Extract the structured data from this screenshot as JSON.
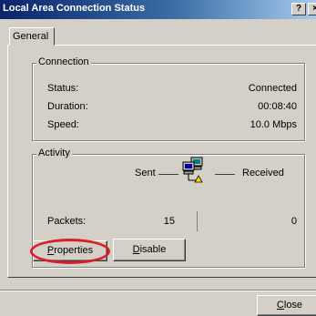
{
  "window": {
    "title": "Local Area Connection Status",
    "help_button": "?",
    "close_button": "×"
  },
  "tabs": [
    "General"
  ],
  "connection": {
    "group_label": "Connection",
    "rows": [
      {
        "label": "Status:",
        "value": "Connected"
      },
      {
        "label": "Duration:",
        "value": "00:08:40"
      },
      {
        "label": "Speed:",
        "value": "10.0 Mbps"
      }
    ]
  },
  "activity": {
    "group_label": "Activity",
    "sent_label": "Sent",
    "received_label": "Received",
    "packets_label": "Packets:",
    "packets_sent": "15",
    "packets_received": "0",
    "icon": "network-computers-icon"
  },
  "buttons": {
    "properties": {
      "accel": "P",
      "rest": "roperties"
    },
    "disable": {
      "accel": "D",
      "rest": "isable"
    },
    "close": {
      "accel": "C",
      "rest": "lose"
    }
  },
  "colors": {
    "highlight_ring": "#d8202a",
    "title_bar": "#0a246a"
  }
}
